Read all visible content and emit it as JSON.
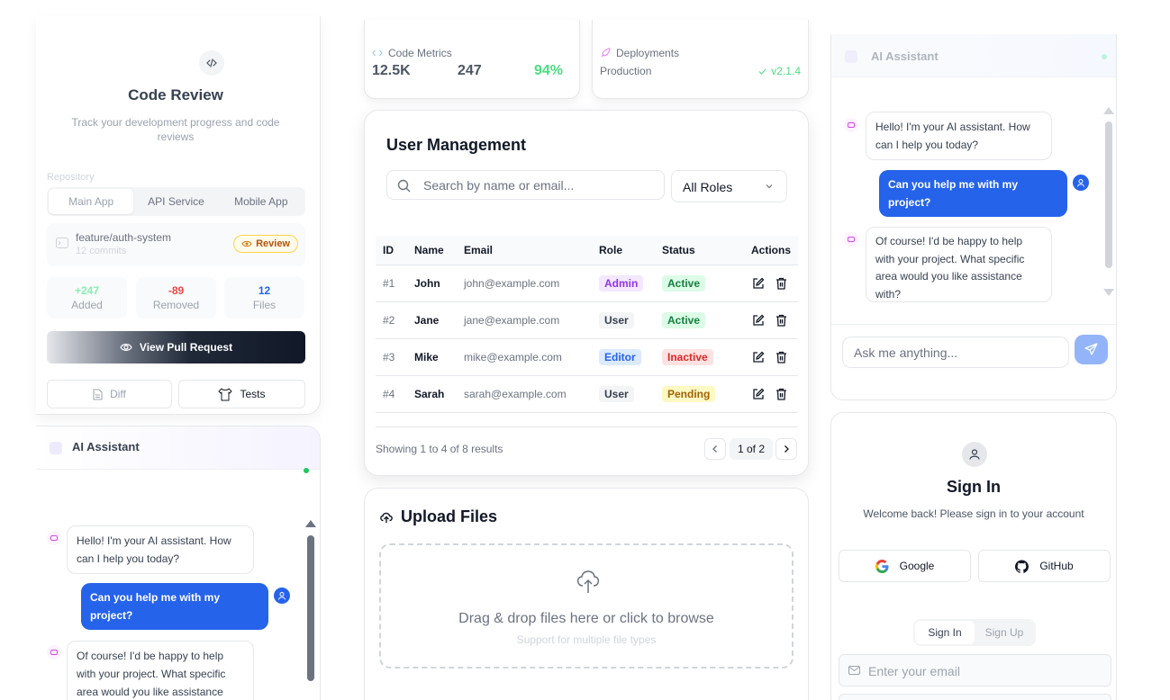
{
  "code_review": {
    "title": "Code Review",
    "subtitle": "Track your development progress and code reviews",
    "repo_label": "Repository",
    "tabs": [
      "Main App",
      "API Service",
      "Mobile App"
    ],
    "branch": "feature/auth-system",
    "commits": "12 commits",
    "badge": "Review",
    "stats": [
      {
        "value": "+247",
        "label": "Added",
        "color": "#86efac"
      },
      {
        "value": "-89",
        "label": "Removed",
        "color": "#ef4444"
      },
      {
        "value": "12",
        "label": "Files",
        "color": "#2563eb"
      }
    ],
    "view_pr": "View Pull Request",
    "diff": "Diff",
    "tests": "Tests"
  },
  "ai_left": {
    "title": "AI Assistant",
    "messages": [
      {
        "from": "bot",
        "text": "Hello! I'm your AI assistant. How can I help you today?"
      },
      {
        "from": "user",
        "text": "Can you help me with my project?"
      },
      {
        "from": "bot",
        "text": "Of course! I'd be happy to help with your project. What specific area would you like assistance"
      }
    ]
  },
  "metrics": {
    "title": "Code Metrics",
    "lines": "12.5K",
    "count": "247",
    "percent": "94%"
  },
  "deployments": {
    "title": "Deployments",
    "env": "Production",
    "version": "v2.1.4"
  },
  "user_mgmt": {
    "title": "User Management",
    "search_placeholder": "Search by name or email...",
    "role_filter": "All Roles",
    "columns": [
      "ID",
      "Name",
      "Email",
      "Role",
      "Status",
      "Actions"
    ],
    "rows": [
      {
        "id": "#1",
        "name": "John",
        "email": "john@example.com",
        "role": "Admin",
        "status": "Active"
      },
      {
        "id": "#2",
        "name": "Jane",
        "email": "jane@example.com",
        "role": "User",
        "status": "Active"
      },
      {
        "id": "#3",
        "name": "Mike",
        "email": "mike@example.com",
        "role": "Editor",
        "status": "Inactive"
      },
      {
        "id": "#4",
        "name": "Sarah",
        "email": "sarah@example.com",
        "role": "User",
        "status": "Pending"
      }
    ],
    "results": "Showing 1 to 4 of 8 results",
    "page": "1 of 2"
  },
  "upload": {
    "title": "Upload Files",
    "drop_text": "Drag & drop files here or click to browse",
    "drop_sub": "Support for multiple file types"
  },
  "ai_right": {
    "title": "AI Assistant",
    "messages": [
      {
        "from": "bot",
        "text": "Hello! I'm your AI assistant. How can I help you today?"
      },
      {
        "from": "user",
        "text": "Can you help me with my project?"
      },
      {
        "from": "bot",
        "text": "Of course! I'd be happy to help with your project. What specific area would you like assistance with?"
      }
    ],
    "input_placeholder": "Ask me anything..."
  },
  "signin": {
    "title": "Sign In",
    "subtitle": "Welcome back! Please sign in to your account",
    "google": "Google",
    "github": "GitHub",
    "tabs": [
      "Sign In",
      "Sign Up"
    ],
    "email_placeholder": "Enter your email"
  },
  "colors": {
    "accent": "#2563eb",
    "success": "#22c55e",
    "danger": "#ef4444",
    "warning": "#f59e0b"
  }
}
